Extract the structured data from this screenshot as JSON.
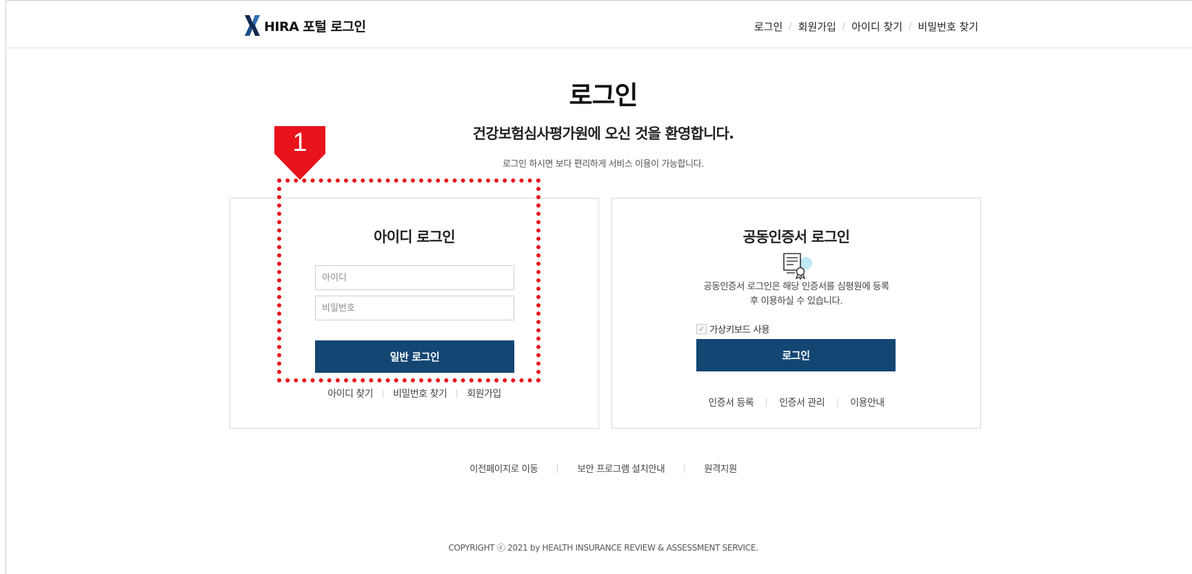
{
  "header": {
    "logo_text": "HIRA 포털 로그인",
    "nav": [
      "로그인",
      "회원가입",
      "아이디 찾기",
      "비밀번호 찾기"
    ],
    "nav_separator": "/"
  },
  "page": {
    "title": "로그인",
    "welcome": "건강보험심사평가원에 오신 것을 환영합니다.",
    "subtext": "로그인 하시면 보다 편리하게 서비스 이용이 가능합니다."
  },
  "id_login": {
    "title": "아이디 로그인",
    "id_placeholder": "아이디",
    "id_value": "",
    "pw_placeholder": "비밀번호",
    "pw_value": "",
    "submit_label": "일반 로그인",
    "links": [
      "아이디 찾기",
      "비밀번호 찾기",
      "회원가입"
    ]
  },
  "cert_login": {
    "title": "공동인증서 로그인",
    "icon": "certificate-icon",
    "desc_line1": "공동인증서 로그인은 해당 인증서를 심평원에 등록",
    "desc_line2": "후 이용하실 수 있습니다.",
    "virtual_keyboard_label": "가상키보드 사용",
    "virtual_keyboard_checked": true,
    "submit_label": "로그인",
    "links": [
      "인증서 등록",
      "인증서 관리",
      "이용안내"
    ]
  },
  "footer": {
    "links": [
      "이전페이지로 이동",
      "보안 프로그램 설치안내",
      "원격지원"
    ],
    "copyright": "COPYRIGHT ⓒ 2021 by HEALTH INSURANCE  REVIEW & ASSESSMENT SERVICE."
  },
  "annotation": {
    "number": "1",
    "color": "#e8131b"
  },
  "colors": {
    "primary_button": "#134673",
    "annotation_red": "#e8131b"
  }
}
